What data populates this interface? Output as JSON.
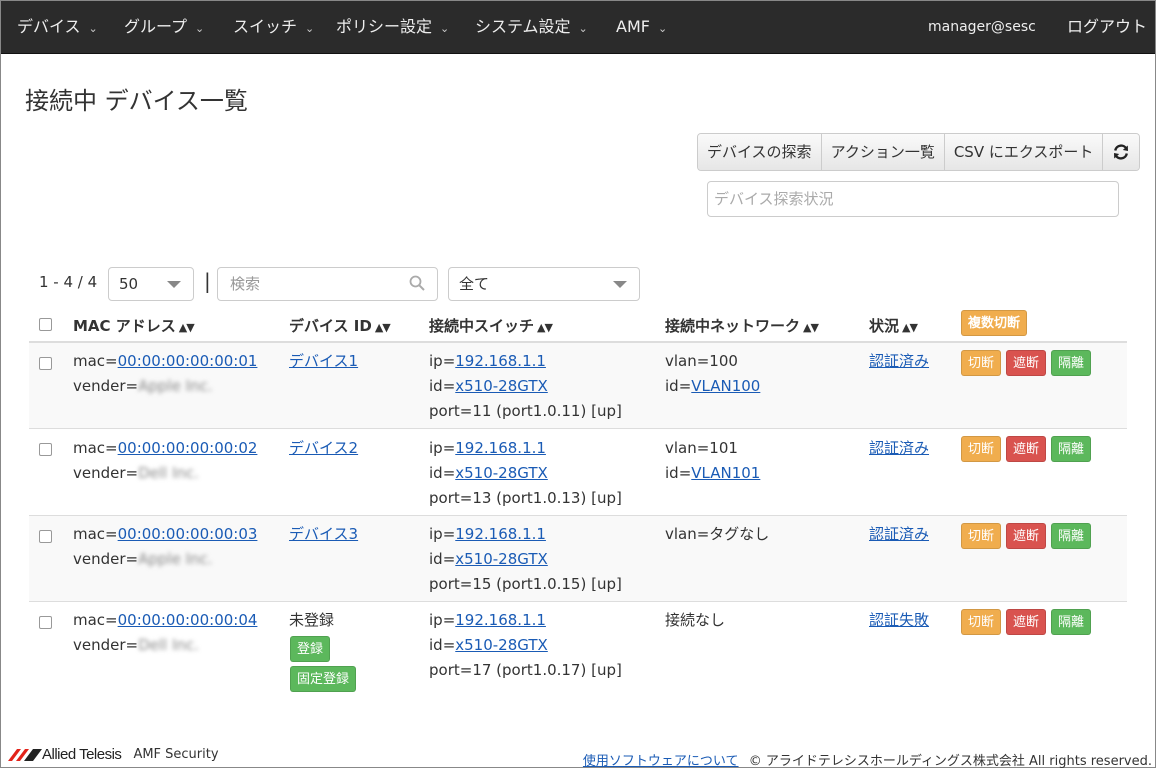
{
  "nav": {
    "items": [
      "デバイス",
      "グループ",
      "スイッチ",
      "ポリシー設定",
      "システム設定",
      "AMF"
    ],
    "user": "manager@sesc",
    "logout": "ログアウト"
  },
  "page": {
    "title": "接続中 デバイス一覧"
  },
  "toolbar": {
    "explore": "デバイスの探索",
    "actions": "アクション一覧",
    "csv": "CSV にエクスポート",
    "refresh_icon": "refresh-icon",
    "scan_placeholder": "デバイス探索状況"
  },
  "filter": {
    "count": "1 - 4 / 4",
    "page_size": "50",
    "pipe": "|",
    "search_placeholder": "検索",
    "status_filter": "全て"
  },
  "table": {
    "headers": {
      "mac": "MAC アドレス",
      "device_id": "デバイス ID",
      "switch": "接続中スイッチ",
      "network": "接続中ネットワーク",
      "status": "状況",
      "bulk_disconnect": "複数切断"
    },
    "rows": [
      {
        "mac_prefix": "mac=",
        "mac": "00:00:00:00:00:01",
        "vendor_prefix": "vender=",
        "vendor": "Apple Inc.",
        "device": "デバイス1",
        "ip_prefix": "ip=",
        "ip": "192.168.1.1",
        "id_prefix": "id=",
        "switch_id": "x510-28GTX",
        "port": "port=11 (port1.0.11) [up]",
        "net1": "vlan=100",
        "net_id_prefix": "id=",
        "net_id": "VLAN100",
        "status": "認証済み"
      },
      {
        "mac_prefix": "mac=",
        "mac": "00:00:00:00:00:02",
        "vendor_prefix": "vender=",
        "vendor": "Dell Inc.",
        "device": "デバイス2",
        "ip_prefix": "ip=",
        "ip": "192.168.1.1",
        "id_prefix": "id=",
        "switch_id": "x510-28GTX",
        "port": "port=13 (port1.0.13) [up]",
        "net1": "vlan=101",
        "net_id_prefix": "id=",
        "net_id": "VLAN101",
        "status": "認証済み"
      },
      {
        "mac_prefix": "mac=",
        "mac": "00:00:00:00:00:03",
        "vendor_prefix": "vender=",
        "vendor": "Apple Inc.",
        "device": "デバイス3",
        "ip_prefix": "ip=",
        "ip": "192.168.1.1",
        "id_prefix": "id=",
        "switch_id": "x510-28GTX",
        "port": "port=15 (port1.0.15) [up]",
        "net1": "vlan=タグなし",
        "status": "認証済み"
      },
      {
        "mac_prefix": "mac=",
        "mac": "00:00:00:00:00:04",
        "vendor_prefix": "vender=",
        "vendor": "Dell Inc.",
        "device_unregistered": "未登録",
        "register": "登録",
        "fixed_register": "固定登録",
        "ip_prefix": "ip=",
        "ip": "192.168.1.1",
        "id_prefix": "id=",
        "switch_id": "x510-28GTX",
        "port": "port=17 (port1.0.17) [up]",
        "net1": "接続なし",
        "status": "認証失敗"
      }
    ],
    "actions": {
      "disconnect": "切断",
      "block": "遮断",
      "isolate": "隔離"
    }
  },
  "footer": {
    "brand": "Allied Telesis",
    "product": "AMF Security",
    "software_link": "使用ソフトウェアについて",
    "copyright": "© アライドテレシスホールディングス株式会社 All rights reserved."
  },
  "colors": {
    "navbar": "#2b2b2b",
    "link": "#1a5bb5",
    "orange": "#f0ad4e",
    "red": "#d9534f",
    "green": "#5cb85c",
    "logo_red": "#e2231a"
  }
}
